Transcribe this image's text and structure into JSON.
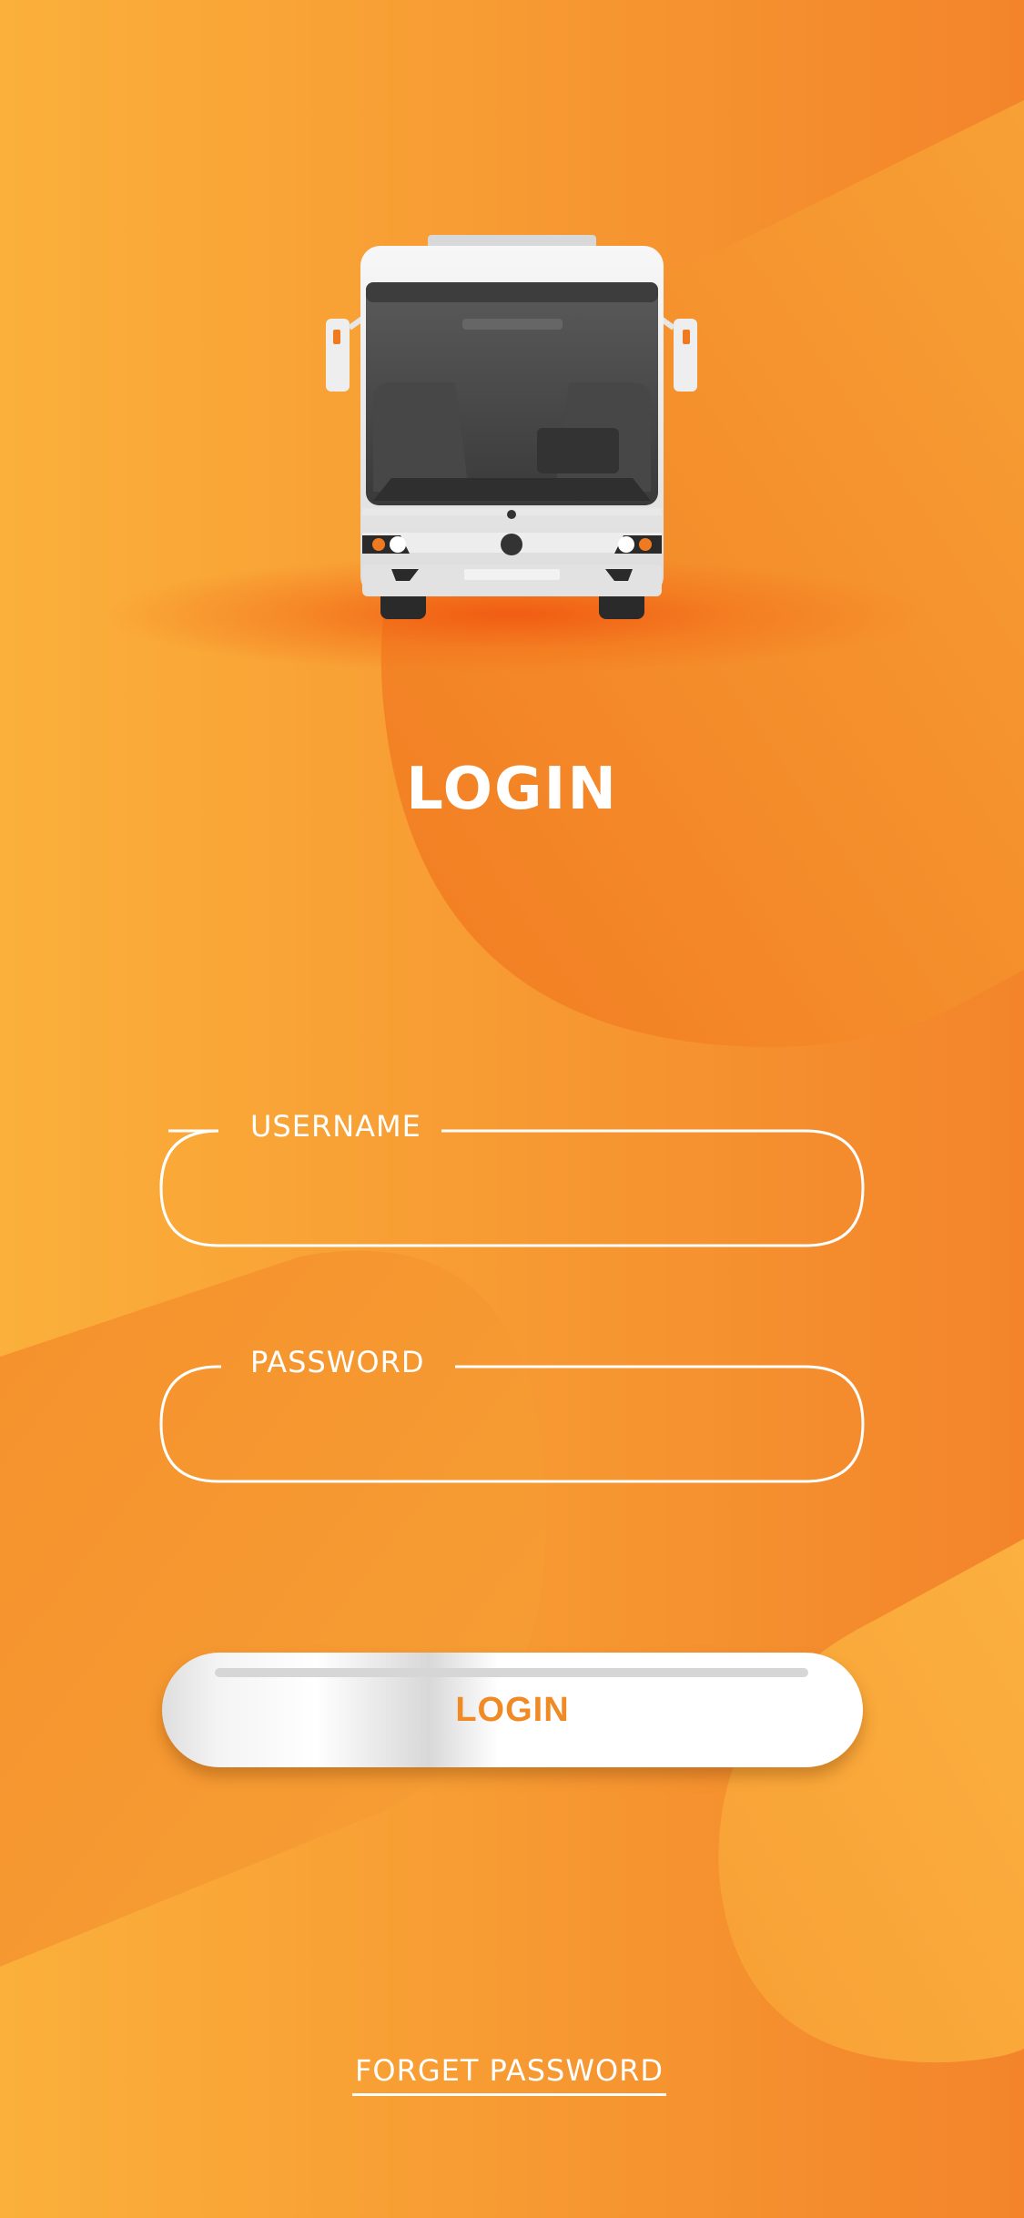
{
  "screen": {
    "title": "LOGIN",
    "brand_colors": {
      "orange_light": "#fbb040",
      "orange_dark": "#f07a20",
      "accent": "#f08a24"
    }
  },
  "illustration": {
    "icon": "bus-icon"
  },
  "form": {
    "username": {
      "label": "USERNAME",
      "value": ""
    },
    "password": {
      "label": "PASSWORD",
      "value": ""
    },
    "submit_label": "LOGIN"
  },
  "links": {
    "forget_password": "FORGET PASSWORD"
  }
}
